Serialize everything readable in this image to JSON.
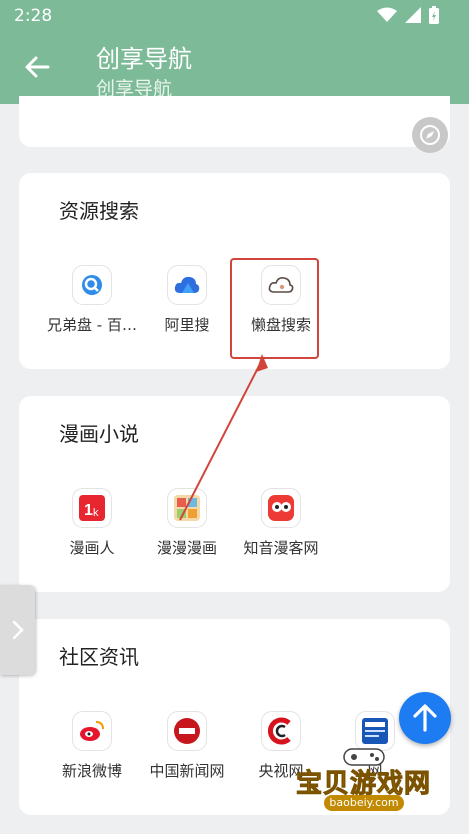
{
  "status_bar": {
    "time": "2:28"
  },
  "app_bar": {
    "title": "创享导航",
    "subtitle": "创享导航"
  },
  "sections": [
    {
      "title": "资源搜索",
      "items": [
        {
          "label": "兄弟盘 - 百…",
          "icon": "search-magnifier-icon"
        },
        {
          "label": "阿里搜",
          "icon": "cloud-icon"
        },
        {
          "label": "懒盘搜索",
          "icon": "lazy-cloud-icon"
        }
      ]
    },
    {
      "title": "漫画小说",
      "items": [
        {
          "label": "漫画人",
          "icon": "manhuaren-icon"
        },
        {
          "label": "漫漫漫画",
          "icon": "manmanmanhua-icon"
        },
        {
          "label": "知音漫客网",
          "icon": "zhiyin-icon"
        }
      ]
    },
    {
      "title": "社区资讯",
      "items": [
        {
          "label": "新浪微博",
          "icon": "weibo-icon"
        },
        {
          "label": "中国新闻网",
          "icon": "chinanews-icon"
        },
        {
          "label": "央视网",
          "icon": "cctv-icon"
        },
        {
          "label": "网",
          "icon": "news-icon"
        }
      ]
    }
  ],
  "watermark": {
    "text": "宝贝游戏网",
    "url": "baobeiy.com"
  },
  "colors": {
    "app_bar": "#7dbb98",
    "accent": "#1d7cf2",
    "highlight": "#d1453b"
  }
}
